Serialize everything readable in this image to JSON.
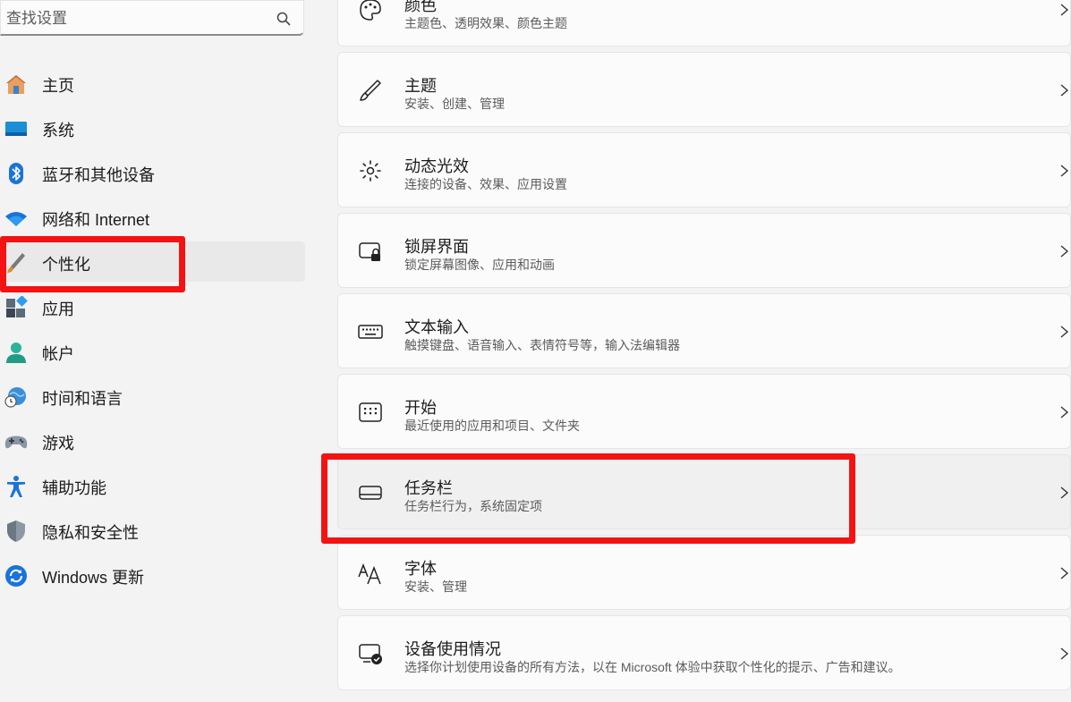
{
  "search": {
    "placeholder": "查找设置",
    "value": ""
  },
  "sidebar": {
    "items": [
      {
        "label": "主页",
        "icon": "home-icon"
      },
      {
        "label": "系统",
        "icon": "system-icon"
      },
      {
        "label": "蓝牙和其他设备",
        "icon": "bluetooth-icon"
      },
      {
        "label": "网络和 Internet",
        "icon": "wifi-icon"
      },
      {
        "label": "个性化",
        "icon": "brush-icon",
        "selected": true
      },
      {
        "label": "应用",
        "icon": "apps-icon"
      },
      {
        "label": "帐户",
        "icon": "account-icon"
      },
      {
        "label": "时间和语言",
        "icon": "globe-clock-icon"
      },
      {
        "label": "游戏",
        "icon": "gamepad-icon"
      },
      {
        "label": "辅助功能",
        "icon": "accessibility-icon"
      },
      {
        "label": "隐私和安全性",
        "icon": "shield-icon"
      },
      {
        "label": "Windows 更新",
        "icon": "update-icon"
      }
    ]
  },
  "main": {
    "cards": [
      {
        "title": "颜色",
        "subtitle": "主题色、透明效果、颜色主题",
        "icon": "palette-icon"
      },
      {
        "title": "主题",
        "subtitle": "安装、创建、管理",
        "icon": "brush-icon"
      },
      {
        "title": "动态光效",
        "subtitle": "连接的设备、效果、应用设置",
        "icon": "lighting-icon"
      },
      {
        "title": "锁屏界面",
        "subtitle": "锁定屏幕图像、应用和动画",
        "icon": "lock-screen-icon"
      },
      {
        "title": "文本输入",
        "subtitle": "触摸键盘、语音输入、表情符号等，输入法编辑器",
        "icon": "keyboard-icon"
      },
      {
        "title": "开始",
        "subtitle": "最近使用的应用和项目、文件夹",
        "icon": "start-icon"
      },
      {
        "title": "任务栏",
        "subtitle": "任务栏行为，系统固定项",
        "icon": "taskbar-icon"
      },
      {
        "title": "字体",
        "subtitle": "安装、管理",
        "icon": "font-icon"
      },
      {
        "title": "设备使用情况",
        "subtitle": "选择你计划使用设备的所有方法，以在 Microsoft 体验中获取个性化的提示、广告和建议。",
        "icon": "device-usage-icon"
      }
    ]
  },
  "colors": {
    "accent": "#0067c0",
    "annotation": "#f41212",
    "selected_bg": "#e9e9e9"
  }
}
